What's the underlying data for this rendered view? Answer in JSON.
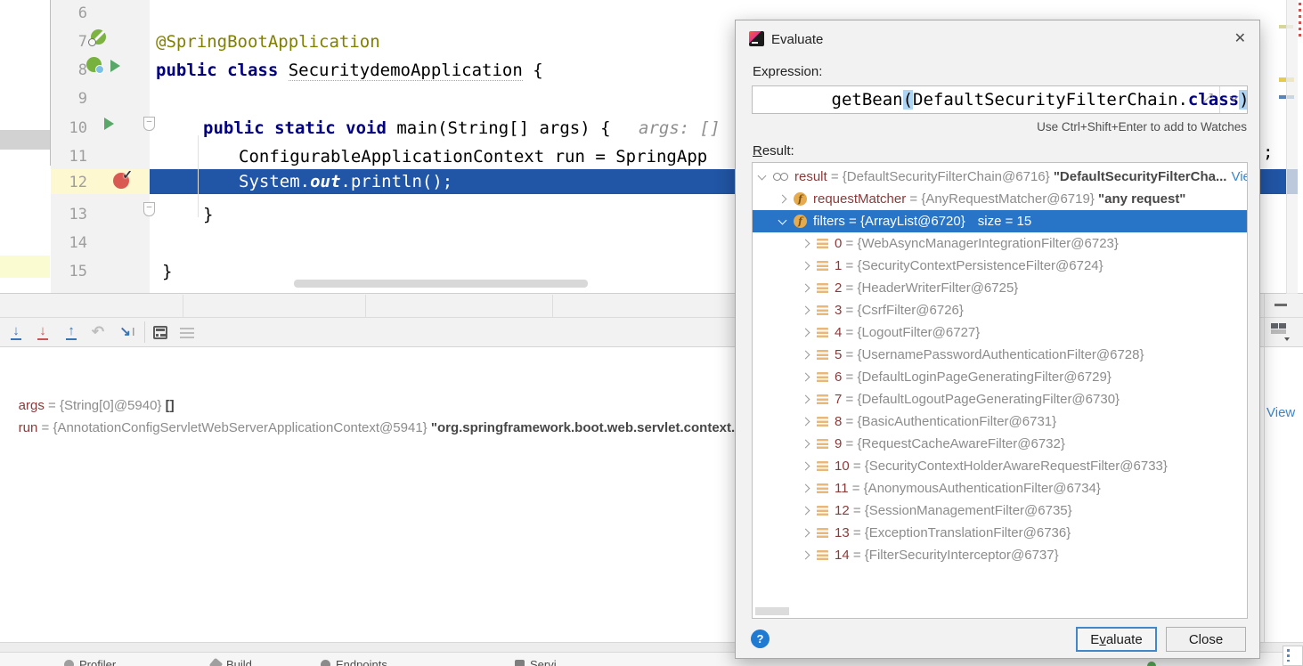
{
  "colors": {
    "selection_blue": "#2874c7",
    "execution_line_blue": "#2155a5",
    "breakpoint_red": "#d95a52",
    "keyword_navy": "#000080",
    "annotation_olive": "#808000",
    "debug_name_maroon": "#8b3a3a",
    "value_gray": "#8c8c8c",
    "link_blue": "#3e86c7",
    "run_green": "#59a869",
    "help_blue": "#1f7ad1"
  },
  "icons": {
    "close": "✕",
    "help": "?",
    "step_into": "↓",
    "force_step_into": "↓",
    "step_out": "↑",
    "drop_frame": "↶",
    "run_to_cursor": "↘",
    "run_to_cursor_caret": "I",
    "expand": "⤢",
    "fold": "–"
  },
  "editor": {
    "line_numbers": [
      "6",
      "7",
      "8",
      "9",
      "10",
      "11",
      "12",
      "13",
      "14",
      "15"
    ],
    "line7": {
      "annotation": "@SpringBootApplication"
    },
    "line8": {
      "keyword": "public class ",
      "class_name": "SecuritydemoApplication",
      "brace": " {"
    },
    "line10": {
      "keyword": "public static void ",
      "code": "main(String[] args) { ",
      "hint": "args: []"
    },
    "line11": {
      "code": "ConfigurableApplicationContext run = SpringApp",
      "tail": ";"
    },
    "line12": {
      "pre": "System.",
      "field": "out",
      "post": ".println();"
    },
    "line13": {
      "brace": "}"
    },
    "line15": {
      "brace": "}"
    }
  },
  "debugger": {
    "variables": [
      {
        "name": "args",
        "ref": " = {String[0]@5940} ",
        "value": "[]"
      },
      {
        "name": "run",
        "ref": " = {AnnotationConfigServletWebServerApplicationContext@5941} ",
        "value": "\"org.springframework.boot.web.servlet.context.Annot"
      }
    ],
    "view_link": "View"
  },
  "dialog": {
    "title": "Evaluate",
    "expression_label": "Expression:",
    "expression": {
      "func": "getBean",
      "open": "(",
      "arg": "DefaultSecurityFilterChain.",
      "keyword": "class",
      "close": ")"
    },
    "hint": "Use Ctrl+Shift+Enter to add to Watches",
    "result_label": {
      "mn": "R",
      "rest": "esult:"
    },
    "tree": {
      "result": {
        "name": "result",
        "ref": " = {DefaultSecurityFilterChain@6716} ",
        "str": "\"DefaultSecurityFilterCha...",
        "link": "View"
      },
      "request_matcher": {
        "name": "requestMatcher",
        "ref": " = {AnyRequestMatcher@6719} ",
        "str": "\"any request\""
      },
      "filters": {
        "name": "filters",
        "ref": " = {ArrayList@6720}",
        "size": "size = 15"
      },
      "items": [
        {
          "index": "0",
          "value": " = {WebAsyncManagerIntegrationFilter@6723}"
        },
        {
          "index": "1",
          "value": " = {SecurityContextPersistenceFilter@6724}"
        },
        {
          "index": "2",
          "value": " = {HeaderWriterFilter@6725}"
        },
        {
          "index": "3",
          "value": " = {CsrfFilter@6726}"
        },
        {
          "index": "4",
          "value": " = {LogoutFilter@6727}"
        },
        {
          "index": "5",
          "value": " = {UsernamePasswordAuthenticationFilter@6728}"
        },
        {
          "index": "6",
          "value": " = {DefaultLoginPageGeneratingFilter@6729}"
        },
        {
          "index": "7",
          "value": " = {DefaultLogoutPageGeneratingFilter@6730}"
        },
        {
          "index": "8",
          "value": " = {BasicAuthenticationFilter@6731}"
        },
        {
          "index": "9",
          "value": " = {RequestCacheAwareFilter@6732}"
        },
        {
          "index": "10",
          "value": " = {SecurityContextHolderAwareRequestFilter@6733}"
        },
        {
          "index": "11",
          "value": " = {AnonymousAuthenticationFilter@6734}"
        },
        {
          "index": "12",
          "value": " = {SessionManagementFilter@6735}"
        },
        {
          "index": "13",
          "value": " = {ExceptionTranslationFilter@6736}"
        },
        {
          "index": "14",
          "value": " = {FilterSecurityInterceptor@6737}"
        }
      ]
    },
    "evaluate_button": {
      "pre": "E",
      "mn": "v",
      "rest": "aluate"
    },
    "close_button": "Close"
  },
  "statusbar": {
    "items": [
      "Profiler",
      "Build",
      "Endpoints",
      "Servi"
    ]
  }
}
